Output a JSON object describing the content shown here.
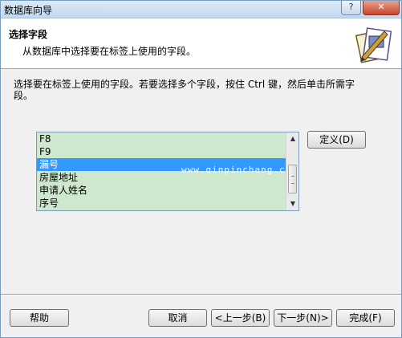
{
  "window": {
    "title": "数据库向导",
    "help_glyph": "?",
    "close_glyph": "✕"
  },
  "header": {
    "title": "选择字段",
    "subtitle": "从数据库中选择要在标签上使用的字段。"
  },
  "instructions": "选择要在标签上使用的字段。若要选择多个字段，按住 Ctrl 键，然后单击所需字段。",
  "field_list": {
    "items": [
      "F8",
      "F9",
      "漏号",
      "房屋地址",
      "申请人姓名",
      "序号"
    ],
    "selected_index": 2,
    "watermark": "www.qinpinchang.com"
  },
  "buttons": {
    "define": "定义(D)",
    "help": "帮助",
    "cancel": "取消",
    "back": "<上一步(B)",
    "next": "下一步(N)>",
    "finish": "完成(F)"
  },
  "icons": {
    "up": "scroll-up-arrow-icon",
    "down": "scroll-down-arrow-icon",
    "wizard": "wizard-label-icon"
  }
}
